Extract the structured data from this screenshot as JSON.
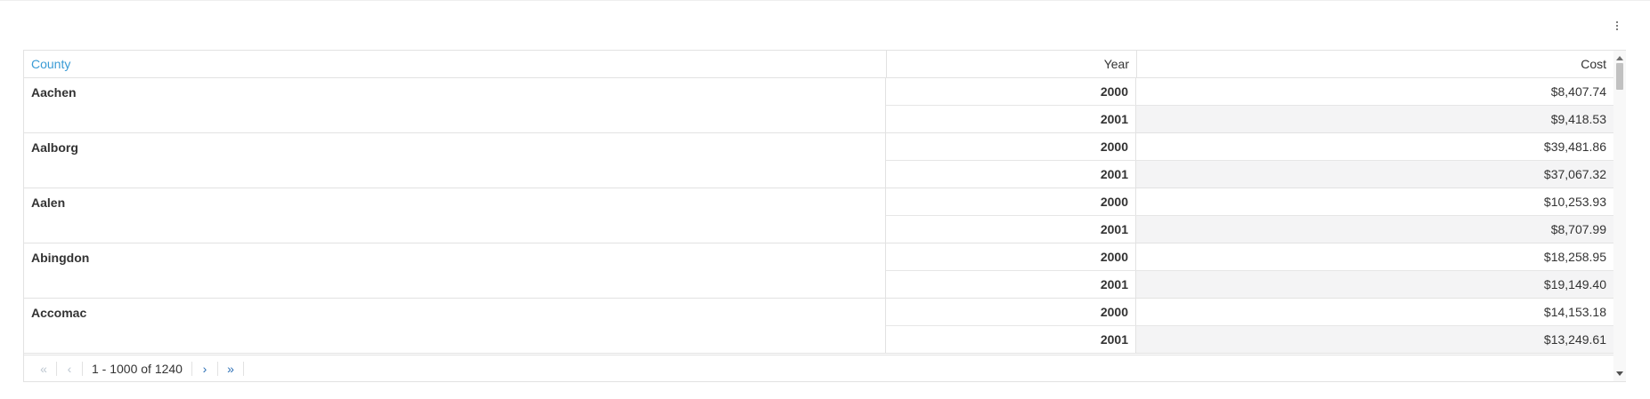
{
  "header": {
    "county_label": "County",
    "year_label": "Year",
    "cost_label": "Cost"
  },
  "rows": [
    {
      "county": "Aachen",
      "entries": [
        {
          "year": "2000",
          "cost": "$8,407.74"
        },
        {
          "year": "2001",
          "cost": "$9,418.53"
        }
      ]
    },
    {
      "county": "Aalborg",
      "entries": [
        {
          "year": "2000",
          "cost": "$39,481.86"
        },
        {
          "year": "2001",
          "cost": "$37,067.32"
        }
      ]
    },
    {
      "county": "Aalen",
      "entries": [
        {
          "year": "2000",
          "cost": "$10,253.93"
        },
        {
          "year": "2001",
          "cost": "$8,707.99"
        }
      ]
    },
    {
      "county": "Abingdon",
      "entries": [
        {
          "year": "2000",
          "cost": "$18,258.95"
        },
        {
          "year": "2001",
          "cost": "$19,149.40"
        }
      ]
    },
    {
      "county": "Accomac",
      "entries": [
        {
          "year": "2000",
          "cost": "$14,153.18"
        },
        {
          "year": "2001",
          "cost": "$13,249.61"
        }
      ]
    }
  ],
  "pager": {
    "first_glyph": "«",
    "prev_glyph": "‹",
    "range_text": "1 - 1000 of 1240",
    "next_glyph": "›",
    "last_glyph": "»"
  },
  "icons": {
    "menu": "kebab-menu-icon",
    "first": "double-chevron-left-icon",
    "prev": "chevron-left-icon",
    "next": "chevron-right-icon",
    "last": "double-chevron-right-icon"
  },
  "colors": {
    "header_accent": "#3a9bd5",
    "pager_active": "#2a6eb5",
    "pager_disabled": "#bcc6d0",
    "alt_row": "#f4f4f5"
  }
}
